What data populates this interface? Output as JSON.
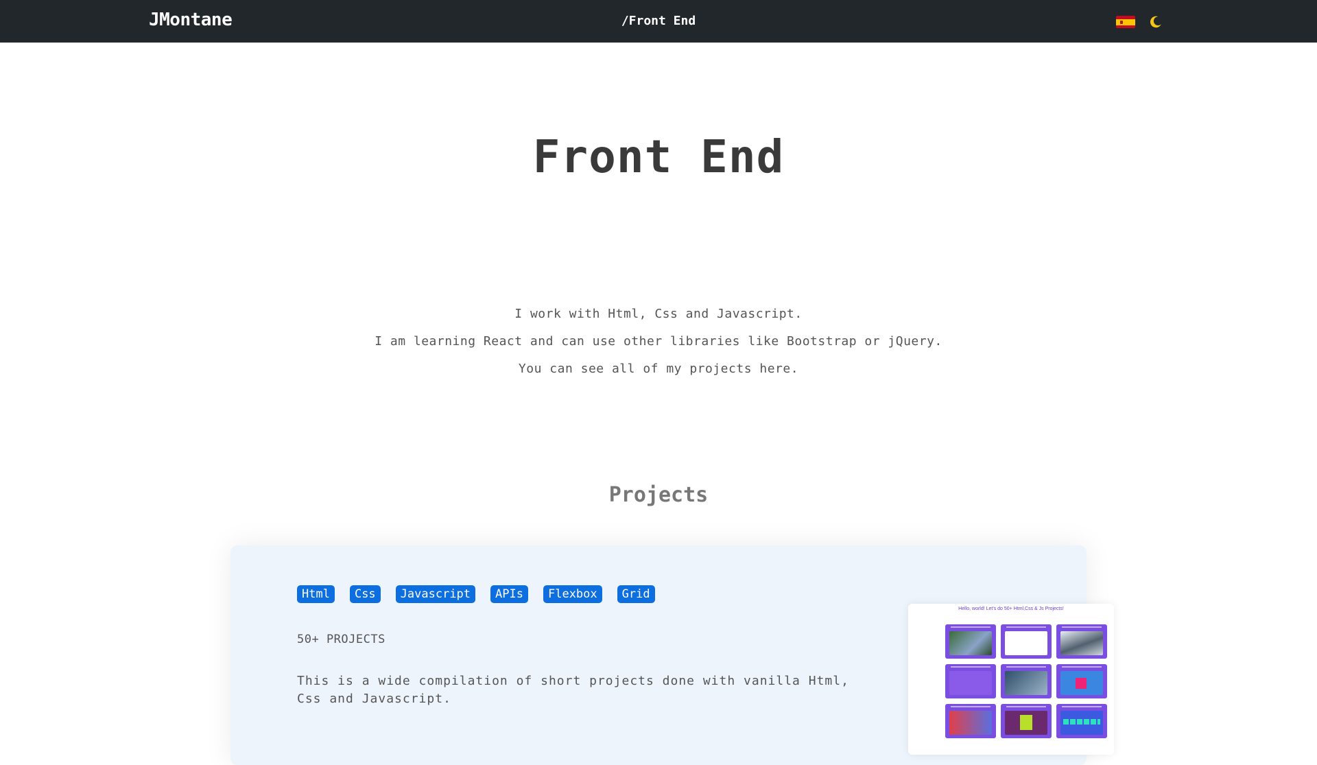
{
  "nav": {
    "brand": "JMontane",
    "breadcrumb": "/Front End",
    "language_flag": "spain-flag-icon",
    "theme_toggle": "moon-icon"
  },
  "hero": {
    "title": "Front End",
    "lines": [
      "I work with Html, Css and Javascript.",
      "I am learning React and can use other libraries like Bootstrap or jQuery.",
      "You can see all of my projects here."
    ]
  },
  "projects": {
    "section_title": "Projects",
    "card": {
      "tags": [
        "Html",
        "Css",
        "Javascript",
        "APIs",
        "Flexbox",
        "Grid"
      ],
      "title": "50+ PROJECTS",
      "description": "This is a wide compilation of short projects done with vanilla Html, Css and Javascript.",
      "preview_title": "Hello, world! Let's do 50+ Html,Css & Js Projects!"
    }
  },
  "colors": {
    "navbar": "#22272c",
    "tag_blue": "#0d6ee0",
    "card_bg": "#eef4fc",
    "moon": "#f5c518"
  }
}
